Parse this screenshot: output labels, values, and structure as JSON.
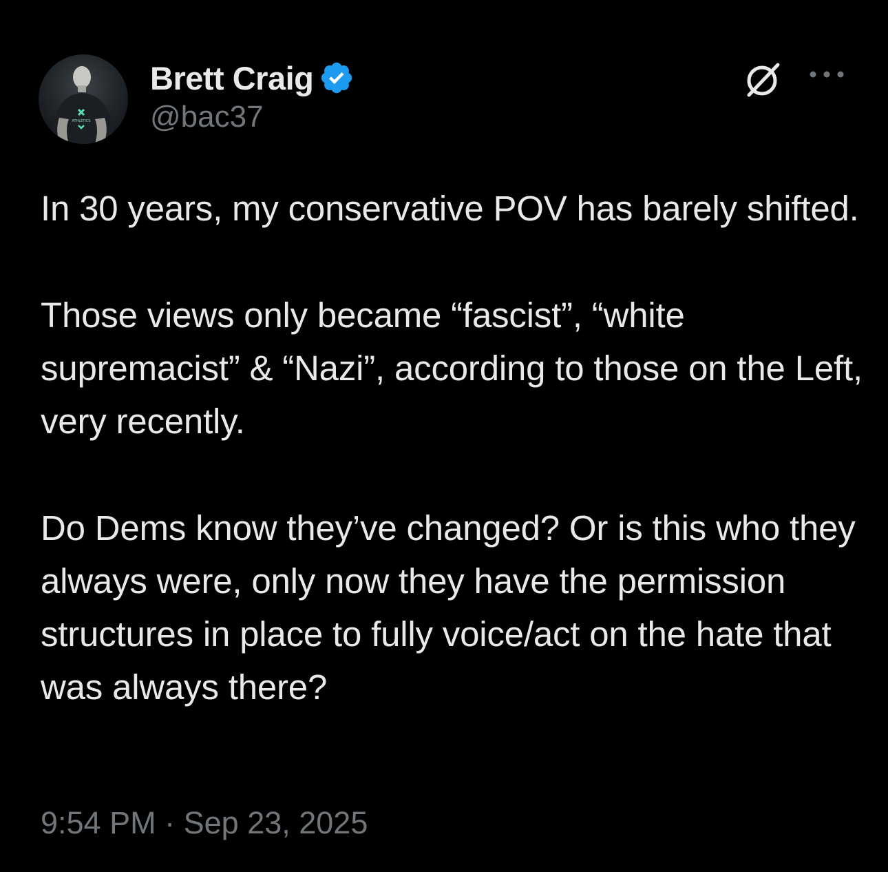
{
  "author": {
    "display_name": "Brett Craig",
    "handle": "@bac37",
    "verified": true
  },
  "icons": {
    "verified": "verified-badge-icon",
    "grok": "grok-icon",
    "more": "more-options-icon"
  },
  "tweet": {
    "paragraphs": [
      "In 30 years, my conservative POV has barely shifted.",
      "Those views only became “fascist”, “white supremacist” &  “Nazi”, according to those on the Left, very recently.",
      "Do Dems know they’ve changed? Or is this who they always were, only now they have the permission structures in place to fully voice/act on the hate that was always there?"
    ],
    "time": "9:54 PM",
    "separator": "·",
    "date": "Sep 23, 2025"
  },
  "colors": {
    "background": "#000000",
    "primary_text": "#e7e9ea",
    "secondary_text": "#71767b",
    "verified_blue": "#1d9bf0"
  }
}
